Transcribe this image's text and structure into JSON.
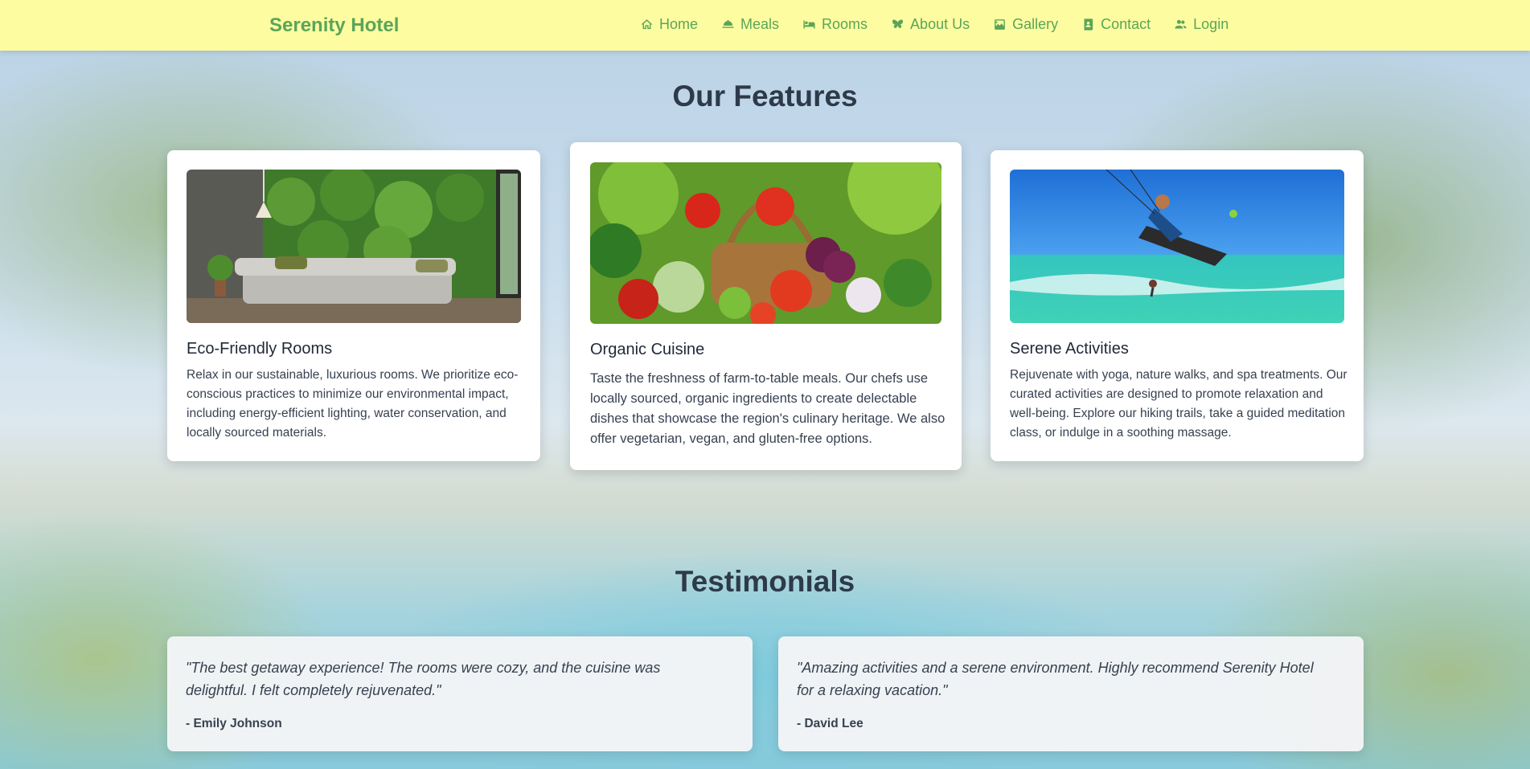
{
  "brand": "Serenity Hotel",
  "nav": [
    {
      "label": "Home",
      "icon": "home-icon"
    },
    {
      "label": "Meals",
      "icon": "cloche-icon"
    },
    {
      "label": "Rooms",
      "icon": "bed-icon"
    },
    {
      "label": "About Us",
      "icon": "butterfly-icon"
    },
    {
      "label": "Gallery",
      "icon": "images-icon"
    },
    {
      "label": "Contact",
      "icon": "contact-book-icon"
    },
    {
      "label": "Login",
      "icon": "users-icon"
    }
  ],
  "features": {
    "title": "Our Features",
    "cards": [
      {
        "title": "Eco-Friendly Rooms",
        "text": "Relax in our sustainable, luxurious rooms. We prioritize eco-conscious practices to minimize our environmental impact, including energy-efficient lighting, water conservation, and locally sourced materials."
      },
      {
        "title": "Organic Cuisine",
        "text": "Taste the freshness of farm-to-table meals. Our chefs use locally sourced, organic ingredients to create delectable dishes that showcase the region's culinary heritage. We also offer vegetarian, vegan, and gluten-free options."
      },
      {
        "title": "Serene Activities",
        "text": "Rejuvenate with yoga, nature walks, and spa treatments. Our curated activities are designed to promote relaxation and well-being. Explore our hiking trails, take a guided meditation class, or indulge in a soothing massage."
      }
    ]
  },
  "testimonials": {
    "title": "Testimonials",
    "items": [
      {
        "quote": "\"The best getaway experience! The rooms were cozy, and the cuisine was delightful. I felt completely rejuvenated.\"",
        "author": "- Emily Johnson"
      },
      {
        "quote": "\"Amazing activities and a serene environment. Highly recommend Serenity Hotel for a relaxing vacation.\"",
        "author": "- David Lee"
      }
    ]
  },
  "colors": {
    "navbar_bg": "#fefca0",
    "brand_green": "#5aa55a",
    "heading": "#2d3a4a"
  }
}
